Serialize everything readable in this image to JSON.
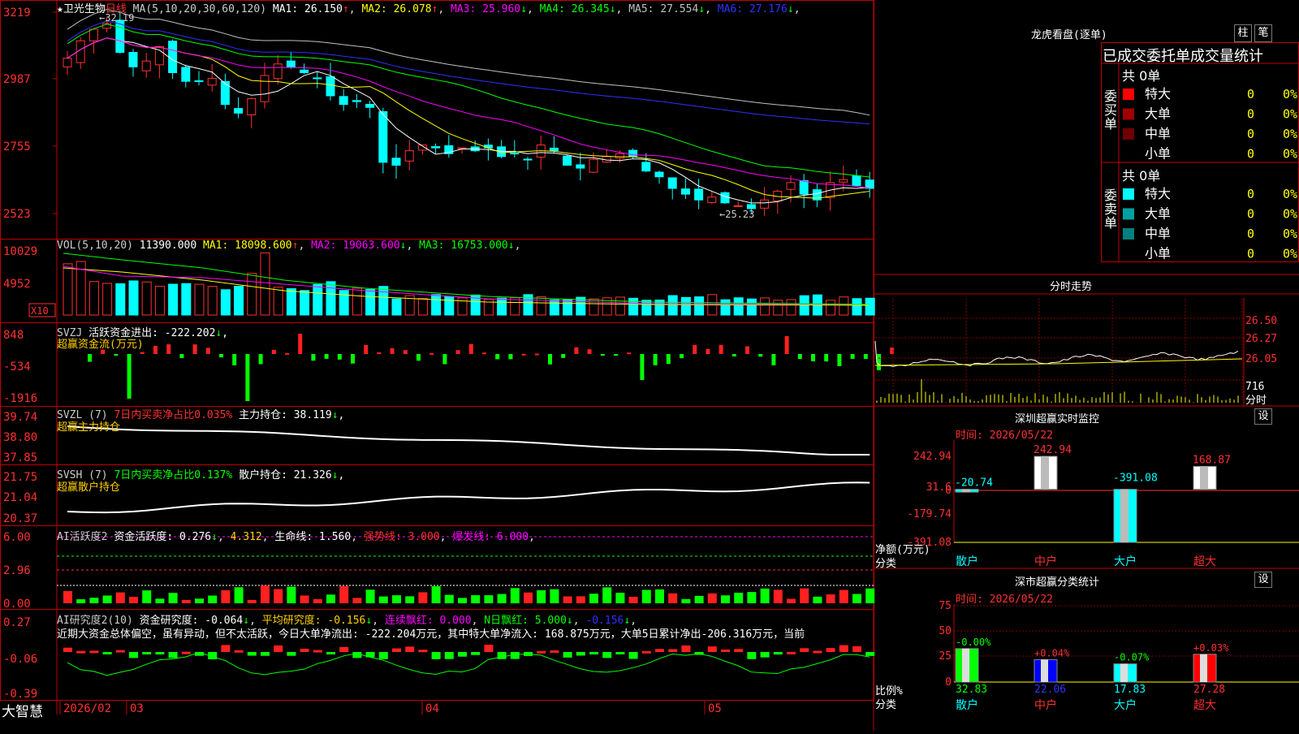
{
  "stock": {
    "name": "★卫光生物",
    "period": "日线"
  },
  "main": {
    "ma_label": "MA(5,10,20,30,60,120)",
    "ma_values": [
      {
        "text": "MA1: 26.150",
        "arrow": "↑",
        "color": "#ffffff"
      },
      {
        "text": "MA2: 26.078",
        "arrow": "↑",
        "color": "#ffff00"
      },
      {
        "text": "MA3: 25.960",
        "arrow": "↓",
        "color": "#ff00ff"
      },
      {
        "text": "MA4: 26.345",
        "arrow": "↓",
        "color": "#00ff00"
      },
      {
        "text": "MA5: 27.554",
        "arrow": "↓",
        "color": "#c0c0c0"
      },
      {
        "text": "MA6: 27.176",
        "arrow": "↓",
        "color": "#3030ff"
      }
    ],
    "y_labels": [
      "3219",
      "2987",
      "2755",
      "2523"
    ],
    "high_mark": "32.19",
    "low_mark": "25.23"
  },
  "vol": {
    "label": "VOL(5,10,20)",
    "value": "11390.000",
    "ma": [
      {
        "text": "MA1: 18098.600",
        "arrow": "↑",
        "color": "#ffff00"
      },
      {
        "text": "MA2: 19063.600",
        "arrow": "↓",
        "color": "#ff00ff"
      },
      {
        "text": "MA3: 16753.000",
        "arrow": "↓",
        "color": "#00ff00"
      }
    ],
    "y_labels": [
      "10029",
      "4952"
    ],
    "unit": "X10"
  },
  "svzj": {
    "label": "SVZJ",
    "desc": "活跃资金进出: -222.202",
    "arrow": "↓",
    "sub": "超赢资金流(万元)",
    "y_labels": [
      "848",
      "-534",
      "-1916"
    ]
  },
  "svzl": {
    "label": "SVZL (7)",
    "desc1": "7日内买卖净占比0.035%",
    "desc2": "主力持仓: 38.119",
    "arrow": "↓",
    "sub": "超赢主力持仓",
    "y_labels": [
      "39.74",
      "38.80",
      "37.85"
    ]
  },
  "svsh": {
    "label": "SVSH (7)",
    "desc1": "7日内买卖净占比0.137%",
    "desc2": "散户持仓: 21.326",
    "arrow": "↓",
    "sub": "超赢散户持仓",
    "y_labels": [
      "21.75",
      "21.04",
      "20.37"
    ]
  },
  "ai1": {
    "label": "AI活跃度2",
    "a": "资金活跃度: 0.276",
    "b": "4.312",
    "c": "生命线: 1.560",
    "d": "强势线: 3.000",
    "e": "爆发线: 6.000",
    "y_labels": [
      "6.00",
      "2.96",
      "0.00"
    ]
  },
  "ai2": {
    "label": "AI研究度2(10)",
    "a": "资金研究度: -0.064",
    "b": "平均研究度: -0.156",
    "c": "连续飘红: 0.000",
    "d": "N日飘红: 5.000",
    "e": "-0.156",
    "comment": "近期大资金总体偏空，虽有异动，但不太活跃，今日大单净流出: -222.204万元，其中特大单净流入: 168.875万元，大单5日累计净出-206.316万元，当前",
    "y_labels": [
      "0.27",
      "-0.06",
      "-0.39"
    ]
  },
  "xaxis": {
    "brand": "大智慧",
    "labels": [
      "2026/02",
      "03",
      "04",
      "05"
    ]
  },
  "right": {
    "longhu_title": "龙虎看盘(逐单)",
    "btn_bar": "柱",
    "btn_pen": "笔",
    "table_head": "已成交委托单成交量统计",
    "buy_group": "委买单",
    "sell_group": "委卖单",
    "buy_total": "共 0单",
    "sell_total": "共 0单",
    "buy_rows": [
      {
        "label": "特大",
        "count": "0",
        "pct": "0%",
        "color": "#ff0000"
      },
      {
        "label": "大单",
        "count": "0",
        "pct": "0%",
        "color": "#a00000"
      },
      {
        "label": "中单",
        "count": "0",
        "pct": "0%",
        "color": "#700000"
      },
      {
        "label": "小单",
        "count": "0",
        "pct": "0%",
        "color": ""
      }
    ],
    "sell_rows": [
      {
        "label": "特大",
        "count": "0",
        "pct": "0%",
        "color": "#00ffff"
      },
      {
        "label": "大单",
        "count": "0",
        "pct": "0%",
        "color": "#00a0a0"
      },
      {
        "label": "中单",
        "count": "0",
        "pct": "0%",
        "color": "#008080"
      },
      {
        "label": "小单",
        "count": "0",
        "pct": "0%",
        "color": ""
      }
    ],
    "intraday_title": "分时走势",
    "intraday_y": [
      "26.50",
      "26.27",
      "26.05"
    ],
    "intraday_vol": "716",
    "intraday_x": "分时",
    "monitor_title": "深圳超赢实时监控",
    "monitor_btn": "设",
    "monitor_time": "时间: 2026/05/22",
    "monitor_y": [
      "242.94",
      "31.6",
      "0",
      "-179.74",
      "-391.08"
    ],
    "monitor_unit": "净额(万元)",
    "monitor_cat": "分类",
    "monitor_bars": [
      {
        "label": "散户",
        "value": -20.74,
        "text": "-20.74",
        "color": "#00ffff"
      },
      {
        "label": "中户",
        "value": 242.94,
        "text": "242.94",
        "color": "#ffffff"
      },
      {
        "label": "大户",
        "value": -391.08,
        "text": "-391.08",
        "color": "#00ffff"
      },
      {
        "label": "超大",
        "value": 168.87,
        "text": "168.87",
        "color": "#ffffff"
      }
    ],
    "class_title": "深市超赢分类统计",
    "class_btn": "设",
    "class_time": "时间: 2026/05/22",
    "class_y": [
      "75",
      "50",
      "25",
      "0"
    ],
    "class_unit": "比例%",
    "class_cat": "分类",
    "class_bars": [
      {
        "label": "散户",
        "value": 32.83,
        "change": "-0.00%",
        "color": "#00ff00"
      },
      {
        "label": "中户",
        "value": 22.06,
        "change": "+0.04%",
        "color": "#0000ff"
      },
      {
        "label": "大户",
        "value": 17.83,
        "change": "-0.07%",
        "color": "#00ffff"
      },
      {
        "label": "超大",
        "value": 27.28,
        "change": "+0.03%",
        "color": "#ff0000"
      }
    ]
  }
}
